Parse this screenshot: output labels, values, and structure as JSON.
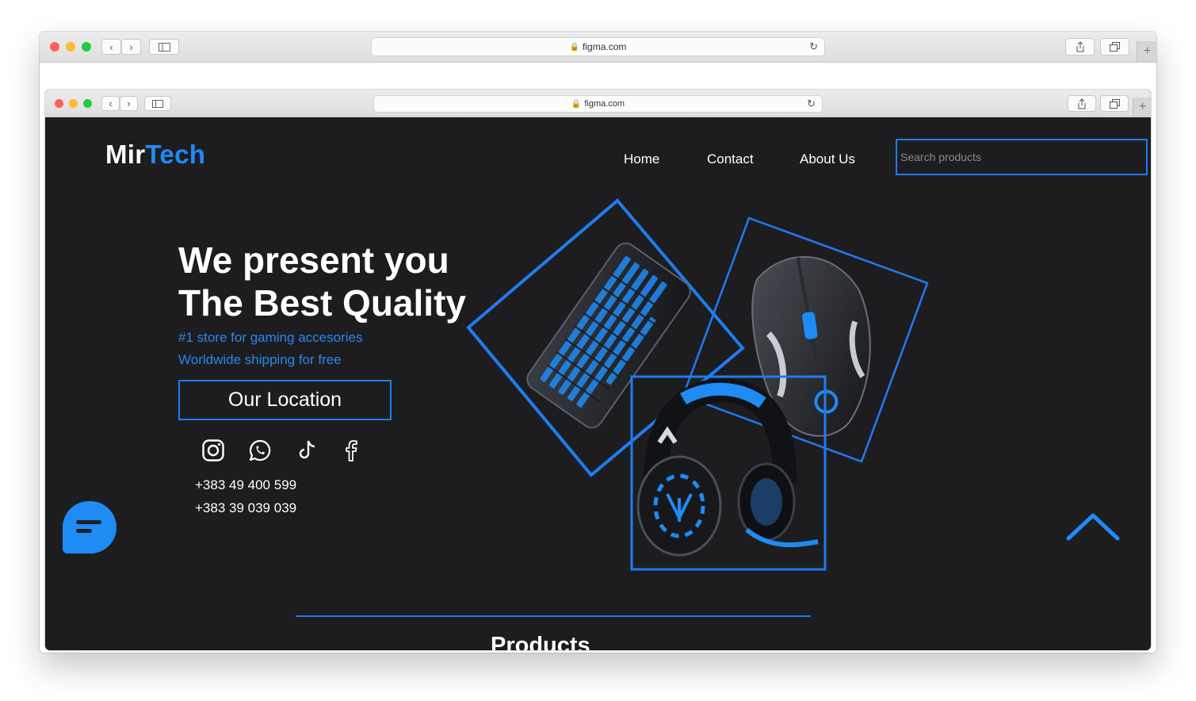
{
  "outer_browser": {
    "url": "figma.com"
  },
  "inner_browser": {
    "url": "figma.com"
  },
  "icons": {
    "lock": "lock-icon",
    "reload": "reload-icon",
    "share": "share-icon",
    "tabs": "tabs-icon",
    "sidebar": "sidebar-icon",
    "back": "chevron-left-icon",
    "forward": "chevron-right-icon",
    "new_tab": "plus-icon",
    "chat": "chat-icon",
    "scroll_top": "chevron-up-icon",
    "social": [
      "instagram-icon",
      "whatsapp-icon",
      "tiktok-icon",
      "facebook-icon"
    ]
  },
  "colors": {
    "accent": "#1f8bf5",
    "background": "#1d1d1f",
    "text": "#ffffff"
  },
  "site": {
    "logo_part1": "Mir",
    "logo_part2": "Tech",
    "nav": {
      "home": "Home",
      "contact": "Contact",
      "about": "About Us"
    },
    "search_placeholder": "Search products",
    "hero": {
      "line1": "We present you",
      "line2": "The Best Quality",
      "sub1": "#1 store for gaming accesories",
      "sub2": "Worldwide shipping for free",
      "button": "Our Location"
    },
    "phones": [
      "+383 49 400 599",
      "+383 39 039 039"
    ],
    "products_title": "Products"
  }
}
